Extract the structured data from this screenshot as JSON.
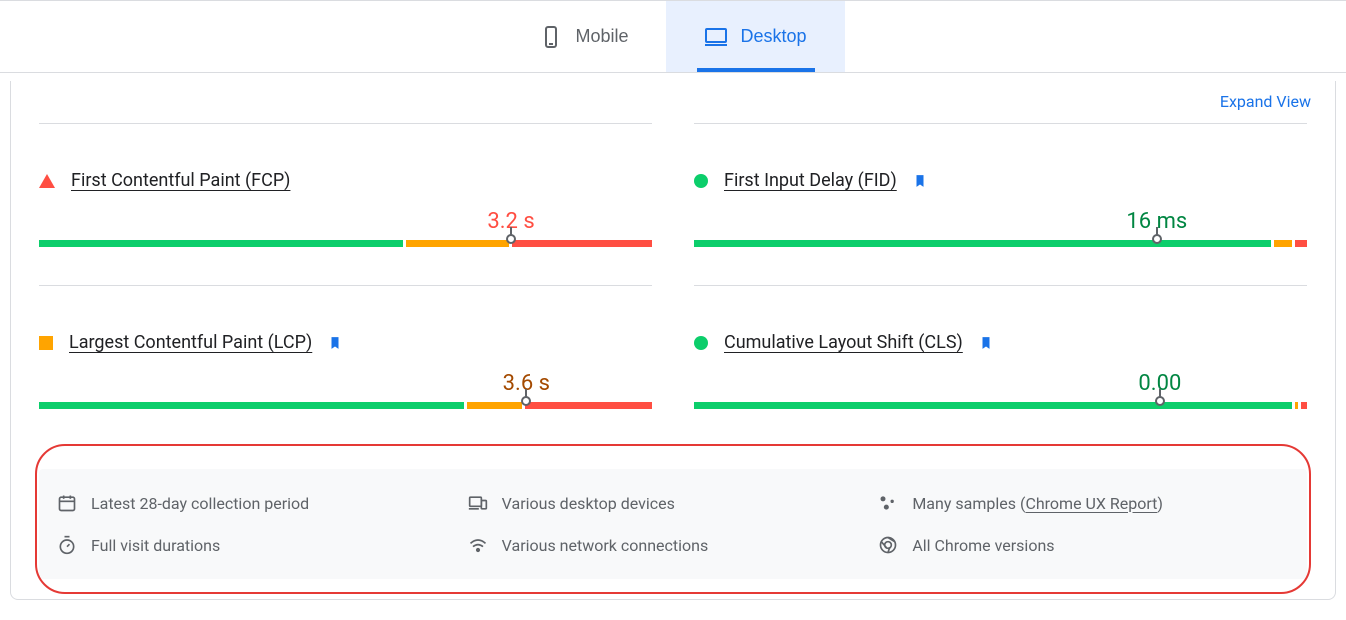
{
  "tabs": {
    "mobile": "Mobile",
    "desktop": "Desktop"
  },
  "expand_view": "Expand View",
  "metrics": {
    "fcp": {
      "name": "First Contentful Paint (FCP)",
      "value": "3.2 s",
      "marker": 77,
      "segments": [
        60,
        17,
        23
      ]
    },
    "lcp": {
      "name": "Largest Contentful Paint (LCP)",
      "value": "3.6 s",
      "marker": 79.5,
      "segments": [
        70,
        9,
        21
      ]
    },
    "fid": {
      "name": "First Input Delay (FID)",
      "value": "16 ms",
      "marker": 75.5,
      "segments": [
        95,
        3,
        2
      ]
    },
    "cls": {
      "name": "Cumulative Layout Shift (CLS)",
      "value": "0.00",
      "marker": 76,
      "segments": [
        98.5,
        0.5,
        1
      ]
    }
  },
  "info": {
    "period": "Latest 28-day collection period",
    "devices": "Various desktop devices",
    "samples_pre": "Many samples (",
    "samples_link": "Chrome UX Report",
    "samples_post": ")",
    "durations": "Full visit durations",
    "network": "Various network connections",
    "versions": "All Chrome versions"
  }
}
